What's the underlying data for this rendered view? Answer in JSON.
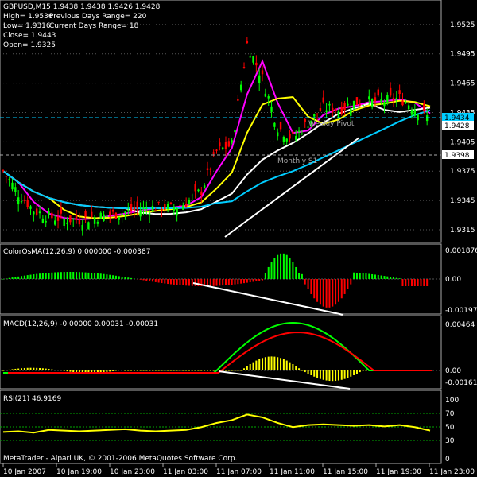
{
  "main": {
    "header_line1": "GBPUSD,M15  1.9438 1.9438 1.9426 1.9428",
    "high": "High= 1.9536",
    "low": "Low= 1.9316",
    "close": "Close= 1.9443",
    "open": "Open= 1.9325",
    "prev_range": "Previous Days Range= 220",
    "curr_range": "Current Days Range= 18",
    "weekly_pivot_label": "Weekly Pivot",
    "monthly_s1_label": "Monthly S1",
    "price_ticks": [
      "1.9525",
      "1.9495",
      "1.9465",
      "1.9435",
      "1.9405",
      "1.9375",
      "1.9345",
      "1.9315"
    ],
    "price_badges": [
      "1.9434",
      "1.9428",
      "1.9398"
    ],
    "y_range": [
      1.9306,
      1.9546
    ]
  },
  "osma": {
    "header": "ColorOsMA(12,26,9) 0.000000 -0.000387",
    "ticks": [
      "0.001876",
      "0.00",
      "-0.00197"
    ]
  },
  "macd": {
    "header": "MACD(12,26,9) -0.00000 0.00031 -0.00031",
    "ticks": [
      "0.00464",
      "0.00",
      "-0.00161"
    ]
  },
  "rsi": {
    "header": "RSI(21) 46.9169",
    "ticks": [
      "100",
      "70",
      "50",
      "30",
      "0"
    ],
    "levels": [
      70,
      50,
      30
    ]
  },
  "footer": "MetaTrader - Alpari UK, © 2001-2006 MetaQuotes Software Corp.",
  "time_labels": [
    "10 Jan 2007",
    "10 Jan 19:00",
    "10 Jan 23:00",
    "11 Jan 03:00",
    "11 Jan 07:00",
    "11 Jan 11:00",
    "11 Jan 15:00",
    "11 Jan 19:00",
    "11 Jan 23:00"
  ],
  "colors": {
    "bg": "#000000",
    "up_candle": "#00ff00",
    "down_candle": "#ff0000",
    "ma_fast": "#ff00ff",
    "ma_mid": "#ffff00",
    "ma_slow": "#ffffff",
    "ma_long": "#00ccff",
    "macd_main": "#00ff00",
    "macd_signal": "#ff0000",
    "histogram": "#ffff00",
    "grid": "#555555",
    "text": "#ffffff"
  },
  "chart_data": {
    "type": "line",
    "price_series": {
      "x_index": [
        0,
        5,
        10,
        15,
        20,
        25,
        30,
        35,
        40,
        45,
        50,
        55,
        60,
        65,
        70,
        75,
        80,
        85,
        90,
        95,
        100,
        105,
        110,
        115,
        120,
        125,
        130,
        135,
        140
      ],
      "close": [
        1.9375,
        1.9352,
        1.9335,
        1.9328,
        1.9326,
        1.9325,
        1.9328,
        1.933,
        1.9333,
        1.9336,
        1.9338,
        1.9337,
        1.9342,
        1.9355,
        1.9395,
        1.9402,
        1.9505,
        1.947,
        1.942,
        1.9408,
        1.9425,
        1.944,
        1.9438,
        1.9445,
        1.9446,
        1.9447,
        1.945,
        1.944,
        1.9428
      ]
    },
    "rsi_values": [
      45,
      46,
      44,
      48,
      47,
      46,
      47,
      48,
      49,
      47,
      46,
      47,
      48,
      52,
      58,
      62,
      70,
      66,
      58,
      52,
      55,
      56,
      55,
      54,
      55,
      53,
      55,
      52,
      47
    ]
  }
}
